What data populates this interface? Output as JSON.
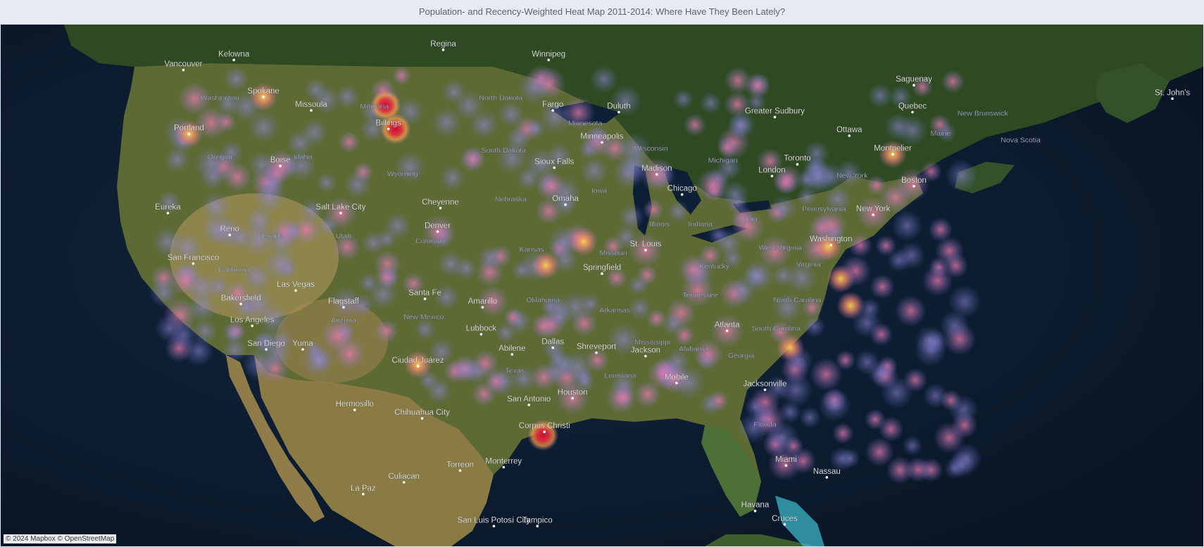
{
  "title": "Population- and Recency-Weighted Heat Map 2011-2014: Where Have They Been Lately?",
  "attribution": "© 2024 Mapbox © OpenStreetMap",
  "colors": {
    "heat_low": "#7b7fd9",
    "heat_mid": "#e86fa0",
    "heat_high": "#f7b23c",
    "heat_core": "#d7263d"
  },
  "places": [
    {
      "name": "Kelowna",
      "lon": -119.5,
      "lat": 49.9
    },
    {
      "name": "Vancouver",
      "lon": -123.1,
      "lat": 49.3
    },
    {
      "name": "Regina",
      "lon": -104.6,
      "lat": 50.5
    },
    {
      "name": "Winnipeg",
      "lon": -97.1,
      "lat": 49.9
    },
    {
      "name": "Spokane",
      "lon": -117.4,
      "lat": 47.7
    },
    {
      "name": "Missoula",
      "lon": -114.0,
      "lat": 46.9
    },
    {
      "name": "Montana",
      "lon": -109.5,
      "lat": 47.0,
      "region": true
    },
    {
      "name": "Billings",
      "lon": -108.5,
      "lat": 45.8
    },
    {
      "name": "North Dakota",
      "lon": -100.5,
      "lat": 47.5,
      "region": true
    },
    {
      "name": "Fargo",
      "lon": -96.8,
      "lat": 46.9
    },
    {
      "name": "Duluth",
      "lon": -92.1,
      "lat": 46.8
    },
    {
      "name": "Minnesota",
      "lon": -94.5,
      "lat": 46.0,
      "region": true
    },
    {
      "name": "Minneapolis",
      "lon": -93.3,
      "lat": 45.0
    },
    {
      "name": "Saguenay",
      "lon": -71.1,
      "lat": 48.4
    },
    {
      "name": "Quebec",
      "lon": -71.2,
      "lat": 46.8
    },
    {
      "name": "St. John's",
      "lon": -52.7,
      "lat": 47.6
    },
    {
      "name": "New Brunswick",
      "lon": -66.2,
      "lat": 46.6,
      "region": true
    },
    {
      "name": "Greater Sudbury",
      "lon": -81.0,
      "lat": 46.5
    },
    {
      "name": "Ottawa",
      "lon": -75.7,
      "lat": 45.4
    },
    {
      "name": "Maine",
      "lon": -69.2,
      "lat": 45.4,
      "region": true
    },
    {
      "name": "Nova Scotia",
      "lon": -63.5,
      "lat": 45.0,
      "region": true
    },
    {
      "name": "Montpelier",
      "lon": -72.6,
      "lat": 44.3
    },
    {
      "name": "Washington",
      "lon": -120.5,
      "lat": 47.5,
      "region": true
    },
    {
      "name": "Portland",
      "lon": -122.7,
      "lat": 45.5
    },
    {
      "name": "Oregon",
      "lon": -120.5,
      "lat": 44.0,
      "region": true
    },
    {
      "name": "Boise",
      "lon": -116.2,
      "lat": 43.6
    },
    {
      "name": "Idaho",
      "lon": -114.6,
      "lat": 44.0,
      "region": true
    },
    {
      "name": "South Dakota",
      "lon": -100.3,
      "lat": 44.4,
      "region": true
    },
    {
      "name": "Sioux Falls",
      "lon": -96.7,
      "lat": 43.5
    },
    {
      "name": "Wisconsin",
      "lon": -89.8,
      "lat": 44.5,
      "region": true
    },
    {
      "name": "Madison",
      "lon": -89.4,
      "lat": 43.1
    },
    {
      "name": "Michigan",
      "lon": -84.7,
      "lat": 43.8,
      "region": true
    },
    {
      "name": "Toronto",
      "lon": -79.4,
      "lat": 43.7
    },
    {
      "name": "London",
      "lon": -81.2,
      "lat": 43.0
    },
    {
      "name": "New York",
      "lon": -75.5,
      "lat": 42.9,
      "region": true
    },
    {
      "name": "Boston",
      "lon": -71.1,
      "lat": 42.4
    },
    {
      "name": "Wyoming",
      "lon": -107.5,
      "lat": 43.0,
      "region": true
    },
    {
      "name": "Eureka",
      "lon": -124.2,
      "lat": 40.8
    },
    {
      "name": "Salt Lake City",
      "lon": -111.9,
      "lat": 40.8
    },
    {
      "name": "Cheyenne",
      "lon": -104.8,
      "lat": 41.1
    },
    {
      "name": "Nebraska",
      "lon": -99.8,
      "lat": 41.5,
      "region": true
    },
    {
      "name": "Omaha",
      "lon": -95.9,
      "lat": 41.3
    },
    {
      "name": "Iowa",
      "lon": -93.5,
      "lat": 42.0,
      "region": true
    },
    {
      "name": "Chicago",
      "lon": -87.6,
      "lat": 41.9
    },
    {
      "name": "Pennsylvania",
      "lon": -77.5,
      "lat": 40.9,
      "region": true
    },
    {
      "name": "New York",
      "lon": -74.0,
      "lat": 40.7
    },
    {
      "name": "Reno",
      "lon": -119.8,
      "lat": 39.5
    },
    {
      "name": "Nevada",
      "lon": -116.9,
      "lat": 39.3,
      "region": true
    },
    {
      "name": "Utah",
      "lon": -111.7,
      "lat": 39.3,
      "region": true
    },
    {
      "name": "Denver",
      "lon": -105.0,
      "lat": 39.7
    },
    {
      "name": "Colorado",
      "lon": -105.5,
      "lat": 39.0,
      "region": true
    },
    {
      "name": "Illinois",
      "lon": -89.2,
      "lat": 40.0,
      "region": true
    },
    {
      "name": "Indiana",
      "lon": -86.3,
      "lat": 40.0,
      "region": true
    },
    {
      "name": "Ohio",
      "lon": -82.8,
      "lat": 40.3,
      "region": true
    },
    {
      "name": "Kansas",
      "lon": -98.3,
      "lat": 38.5,
      "region": true
    },
    {
      "name": "St. Louis",
      "lon": -90.2,
      "lat": 38.6
    },
    {
      "name": "West Virginia",
      "lon": -80.6,
      "lat": 38.6,
      "region": true
    },
    {
      "name": "Washington",
      "lon": -77.0,
      "lat": 38.9
    },
    {
      "name": "San Francisco",
      "lon": -122.4,
      "lat": 37.8
    },
    {
      "name": "California",
      "lon": -119.5,
      "lat": 37.3,
      "region": true
    },
    {
      "name": "Missouri",
      "lon": -92.5,
      "lat": 38.3,
      "region": true
    },
    {
      "name": "Springfield",
      "lon": -93.3,
      "lat": 37.2
    },
    {
      "name": "Kentucky",
      "lon": -85.3,
      "lat": 37.5,
      "region": true
    },
    {
      "name": "Virginia",
      "lon": -78.6,
      "lat": 37.6,
      "region": true
    },
    {
      "name": "Las Vegas",
      "lon": -115.1,
      "lat": 36.2
    },
    {
      "name": "Bakersfield",
      "lon": -119.0,
      "lat": 35.4
    },
    {
      "name": "Flagstaff",
      "lon": -111.7,
      "lat": 35.2
    },
    {
      "name": "Santa Fe",
      "lon": -105.9,
      "lat": 35.7
    },
    {
      "name": "Amarillo",
      "lon": -101.8,
      "lat": 35.2
    },
    {
      "name": "Oklahoma",
      "lon": -97.5,
      "lat": 35.5,
      "region": true
    },
    {
      "name": "Tennessee",
      "lon": -86.3,
      "lat": 35.8,
      "region": true
    },
    {
      "name": "North Carolina",
      "lon": -79.4,
      "lat": 35.5,
      "region": true
    },
    {
      "name": "Los Angeles",
      "lon": -118.2,
      "lat": 34.1
    },
    {
      "name": "Arizona",
      "lon": -111.7,
      "lat": 34.3,
      "region": true
    },
    {
      "name": "New Mexico",
      "lon": -106.0,
      "lat": 34.5,
      "region": true
    },
    {
      "name": "Lubbock",
      "lon": -101.9,
      "lat": 33.6
    },
    {
      "name": "Arkansas",
      "lon": -92.4,
      "lat": 34.9,
      "region": true
    },
    {
      "name": "Atlanta",
      "lon": -84.4,
      "lat": 33.8
    },
    {
      "name": "South Carolina",
      "lon": -80.9,
      "lat": 33.8,
      "region": true
    },
    {
      "name": "San Diego",
      "lon": -117.2,
      "lat": 32.7
    },
    {
      "name": "Yuma",
      "lon": -114.6,
      "lat": 32.7
    },
    {
      "name": "Mississippi",
      "lon": -89.7,
      "lat": 33.0,
      "region": true
    },
    {
      "name": "Dallas",
      "lon": -96.8,
      "lat": 32.8
    },
    {
      "name": "Abilene",
      "lon": -99.7,
      "lat": 32.4
    },
    {
      "name": "Shreveport",
      "lon": -93.7,
      "lat": 32.5
    },
    {
      "name": "Jackson",
      "lon": -90.2,
      "lat": 32.3
    },
    {
      "name": "Alabama",
      "lon": -86.8,
      "lat": 32.6,
      "region": true
    },
    {
      "name": "Georgia",
      "lon": -83.4,
      "lat": 32.2,
      "region": true
    },
    {
      "name": "Ciudad Juárez",
      "lon": -106.4,
      "lat": 31.7
    },
    {
      "name": "Texas",
      "lon": -99.5,
      "lat": 31.3,
      "region": true
    },
    {
      "name": "Houston",
      "lon": -95.4,
      "lat": 29.8
    },
    {
      "name": "Louisiana",
      "lon": -92.0,
      "lat": 31.0,
      "region": true
    },
    {
      "name": "Mobile",
      "lon": -88.0,
      "lat": 30.7
    },
    {
      "name": "Jacksonville",
      "lon": -81.7,
      "lat": 30.3
    },
    {
      "name": "Hermosillo",
      "lon": -110.9,
      "lat": 29.1
    },
    {
      "name": "Chihuahua City",
      "lon": -106.1,
      "lat": 28.6
    },
    {
      "name": "San Antonio",
      "lon": -98.5,
      "lat": 29.4
    },
    {
      "name": "Corpus Christi",
      "lon": -97.4,
      "lat": 27.8
    },
    {
      "name": "Florida",
      "lon": -81.7,
      "lat": 28.1,
      "region": true
    },
    {
      "name": "Torreon",
      "lon": -103.4,
      "lat": 25.5
    },
    {
      "name": "Monterrey",
      "lon": -100.3,
      "lat": 25.7
    },
    {
      "name": "Miami",
      "lon": -80.2,
      "lat": 25.8
    },
    {
      "name": "Nassau",
      "lon": -77.3,
      "lat": 25.1
    },
    {
      "name": "Culiacan",
      "lon": -107.4,
      "lat": 24.8
    },
    {
      "name": "La Paz",
      "lon": -110.3,
      "lat": 24.1
    },
    {
      "name": "Havana",
      "lon": -82.4,
      "lat": 23.1
    },
    {
      "name": "San Luis Potosí City",
      "lon": -101.0,
      "lat": 22.2
    },
    {
      "name": "Tampico",
      "lon": -97.9,
      "lat": 22.2
    },
    {
      "name": "Cruces",
      "lon": -80.3,
      "lat": 22.3
    }
  ],
  "hotspots": [
    {
      "lon": -108.7,
      "lat": 47.2,
      "level": "core"
    },
    {
      "lon": -108.0,
      "lat": 45.8,
      "level": "core"
    },
    {
      "lon": -97.5,
      "lat": 27.6,
      "level": "core"
    },
    {
      "lon": -97.3,
      "lat": 37.7,
      "level": "high"
    },
    {
      "lon": -94.6,
      "lat": 39.1,
      "level": "high"
    },
    {
      "lon": -76.3,
      "lat": 36.9,
      "level": "high"
    },
    {
      "lon": -77.2,
      "lat": 38.8,
      "level": "high"
    },
    {
      "lon": -75.6,
      "lat": 35.3,
      "level": "high"
    },
    {
      "lon": -79.9,
      "lat": 32.8,
      "level": "high"
    },
    {
      "lon": -122.7,
      "lat": 45.5,
      "level": "high"
    },
    {
      "lon": -117.4,
      "lat": 47.7,
      "level": "high"
    },
    {
      "lon": -106.4,
      "lat": 31.8,
      "level": "high"
    },
    {
      "lon": -72.6,
      "lat": 44.3,
      "level": "high"
    },
    {
      "lon": -89.4,
      "lat": 43.1,
      "level": "mid"
    },
    {
      "lon": -84.4,
      "lat": 33.8,
      "level": "mid"
    },
    {
      "lon": -81.0,
      "lat": 38.5,
      "level": "mid"
    },
    {
      "lon": -86.5,
      "lat": 36.2,
      "level": "mid"
    },
    {
      "lon": -90.2,
      "lat": 38.6,
      "level": "mid"
    },
    {
      "lon": -82.9,
      "lat": 40.0,
      "level": "mid"
    },
    {
      "lon": -74.0,
      "lat": 40.8,
      "level": "mid"
    },
    {
      "lon": -71.2,
      "lat": 42.5,
      "level": "mid"
    },
    {
      "lon": -111.9,
      "lat": 40.8,
      "level": "mid"
    },
    {
      "lon": -104.9,
      "lat": 39.7,
      "level": "mid"
    },
    {
      "lon": -112.1,
      "lat": 33.5,
      "level": "mid"
    },
    {
      "lon": -95.4,
      "lat": 29.8,
      "level": "mid"
    },
    {
      "lon": -81.4,
      "lat": 28.5,
      "level": "mid"
    },
    {
      "lon": -80.3,
      "lat": 25.9,
      "level": "mid"
    },
    {
      "lon": -122.3,
      "lat": 47.6,
      "level": "mid"
    },
    {
      "lon": -116.2,
      "lat": 43.6,
      "level": "mid"
    }
  ]
}
